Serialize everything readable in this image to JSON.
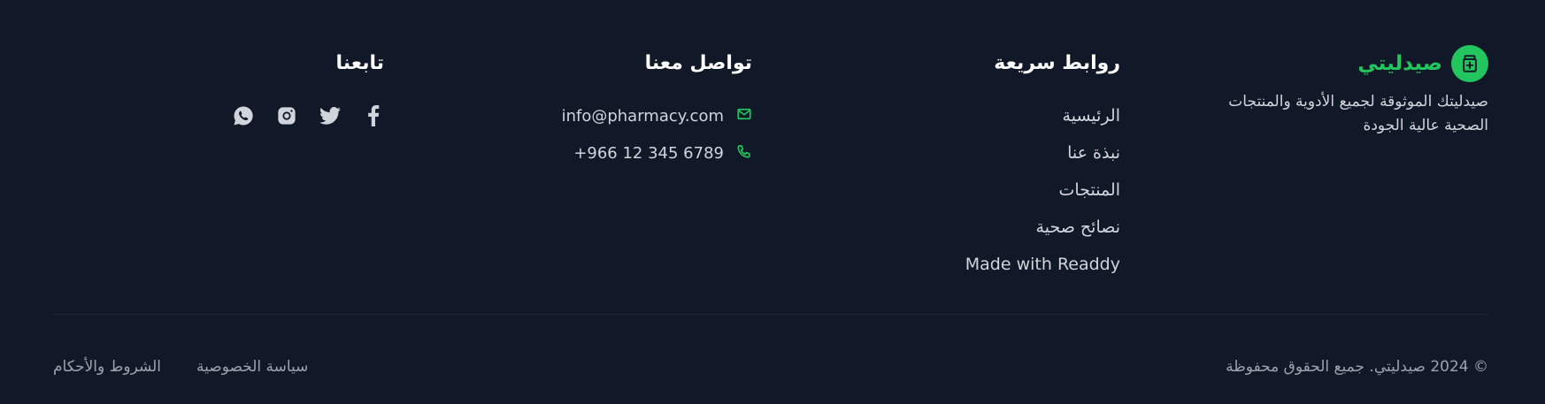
{
  "brand": {
    "name": "صيدليتي",
    "description": "صيدليتك الموثوقة لجميع الأدوية والمنتجات الصحية عالية الجودة"
  },
  "quick_links": {
    "title": "روابط سريعة",
    "items": [
      "الرئيسية",
      "نبذة عنا",
      "المنتجات",
      "نصائح صحية",
      "Made with Readdy"
    ]
  },
  "contact": {
    "title": "تواصل معنا",
    "email": "info@pharmacy.com",
    "phone": "+966 12 345 6789"
  },
  "follow": {
    "title": "تابعنا",
    "icons": [
      "facebook-icon",
      "twitter-icon",
      "instagram-icon",
      "whatsapp-icon"
    ]
  },
  "bottom": {
    "copyright": "© 2024 صيدليتي. جميع الحقوق محفوظة",
    "privacy": "سياسة الخصوصية",
    "terms": "الشروط والأحكام"
  },
  "colors": {
    "background": "#111827",
    "accent": "#22c55e",
    "text": "#d1d5db",
    "muted": "#9ca3af"
  }
}
